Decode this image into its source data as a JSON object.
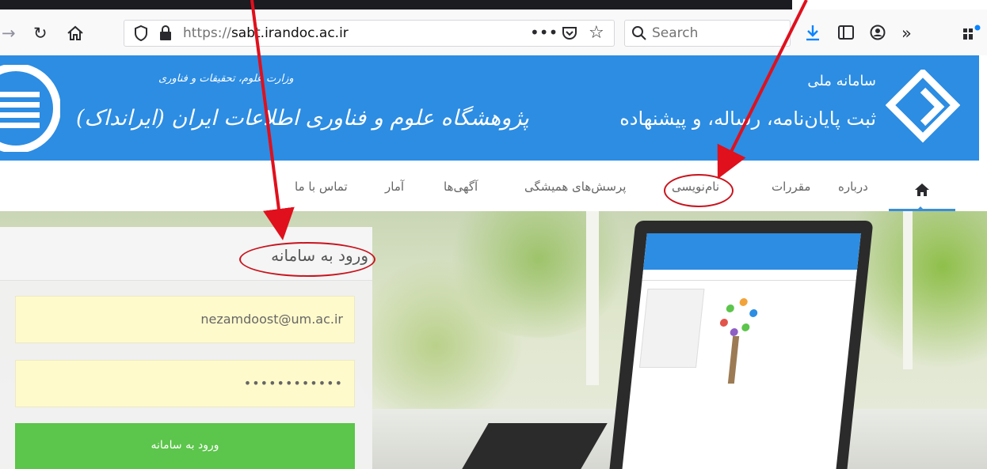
{
  "browser": {
    "url_prefix": "https://",
    "url_host": "sabt.irandoc.ac.ir",
    "search_placeholder": "Search"
  },
  "banner": {
    "system_label": "سامانه ملی",
    "system_title": "ثبت پایان‌نامه، رساله، و پیشنهاده",
    "ministry_label": "وزارت علوم، تحقیقات و فناوری",
    "org_name": "پژوهشگاه علوم و فناوری اطلاعات ایران (ایرانداک)"
  },
  "nav": {
    "items": [
      {
        "label": "درباره"
      },
      {
        "label": "مقررات"
      },
      {
        "label": "نام‌نویسی"
      },
      {
        "label": "پرسش‌های همیشگی"
      },
      {
        "label": "آگهی‌ها"
      },
      {
        "label": "آمار"
      },
      {
        "label": "تماس با ما"
      }
    ]
  },
  "login": {
    "title": "ورود به سامانه",
    "email_value": "nezamdoost@um.ac.ir",
    "password_value": "••••••••••••",
    "submit_label": "ورود به سامانه"
  },
  "colors": {
    "banner": "#2c8de3",
    "login_button": "#5cc54b",
    "field_bg": "#fffacb",
    "annotation": "#c8141e"
  }
}
